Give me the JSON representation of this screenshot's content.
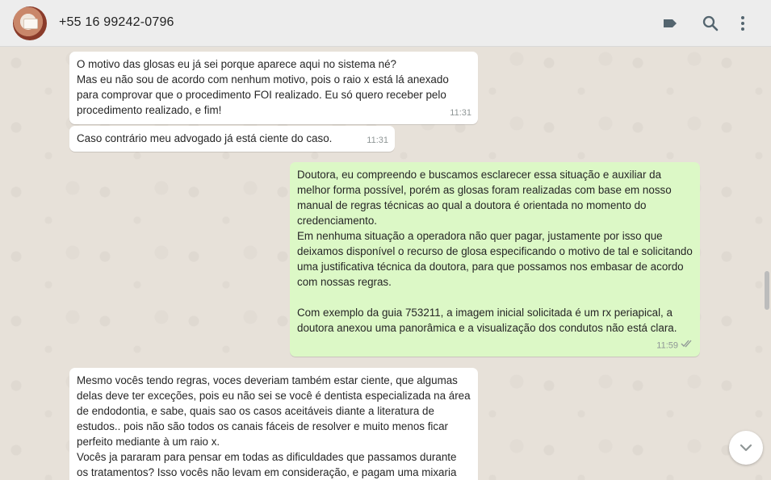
{
  "header": {
    "contact_name": "+55 16 99242-0796",
    "icons": [
      "label-icon",
      "search-icon",
      "menu-icon"
    ]
  },
  "messages": [
    {
      "direction": "incoming",
      "text": "O motivo das glosas eu já sei porque aparece aqui no sistema né?\nMas eu não sou de acordo com nenhum motivo, pois o raio x está lá anexado para comprovar que o procedimento FOI realizado. Eu só quero receber pelo procedimento realizado, e fim!",
      "time": "11:31"
    },
    {
      "direction": "incoming",
      "text": "Caso contrário meu advogado já está ciente do caso.",
      "time": "11:31"
    },
    {
      "direction": "outgoing",
      "text": "Doutora, eu compreendo e buscamos esclarecer essa situação e auxiliar da melhor forma possível, porém as glosas foram realizadas com base em nosso manual de regras técnicas ao qual a doutora é orientada no momento do credenciamento.\nEm nenhuma situação a operadora não quer pagar, justamente por isso que deixamos disponível o recurso de glosa especificando o motivo de tal e solicitando uma justificativa técnica da doutora, para que possamos nos embasar de acordo com nossas regras.\n\nCom exemplo da guia 753211, a imagem inicial solicitada é um rx periapical, a doutora anexou uma panorâmica e a visualização dos condutos não está clara.",
      "time": "11:59",
      "status": "read"
    },
    {
      "direction": "incoming",
      "text": "Mesmo vocês tendo regras, voces deveriam também estar ciente, que algumas delas deve ter exceções, pois eu não sei se você é dentista especializada na área de endodontia, e sabe, quais sao os casos aceitáveis diante a literatura de estudos.. pois não são todos os canais fáceis de resolver e muito menos ficar perfeito mediante à um raio x.\nVocês ja pararam para pensar em todas as dificuldades que passamos durante os tratamentos? Isso vocês não levam em consideração, e pagam uma mixaria",
      "time": ""
    }
  ],
  "colors": {
    "header_bg": "#ededed",
    "incoming_bubble": "#ffffff",
    "outgoing_bubble": "#dcf8c6",
    "chat_bg": "#e5ddd5",
    "read_ticks": "#8f9696"
  }
}
